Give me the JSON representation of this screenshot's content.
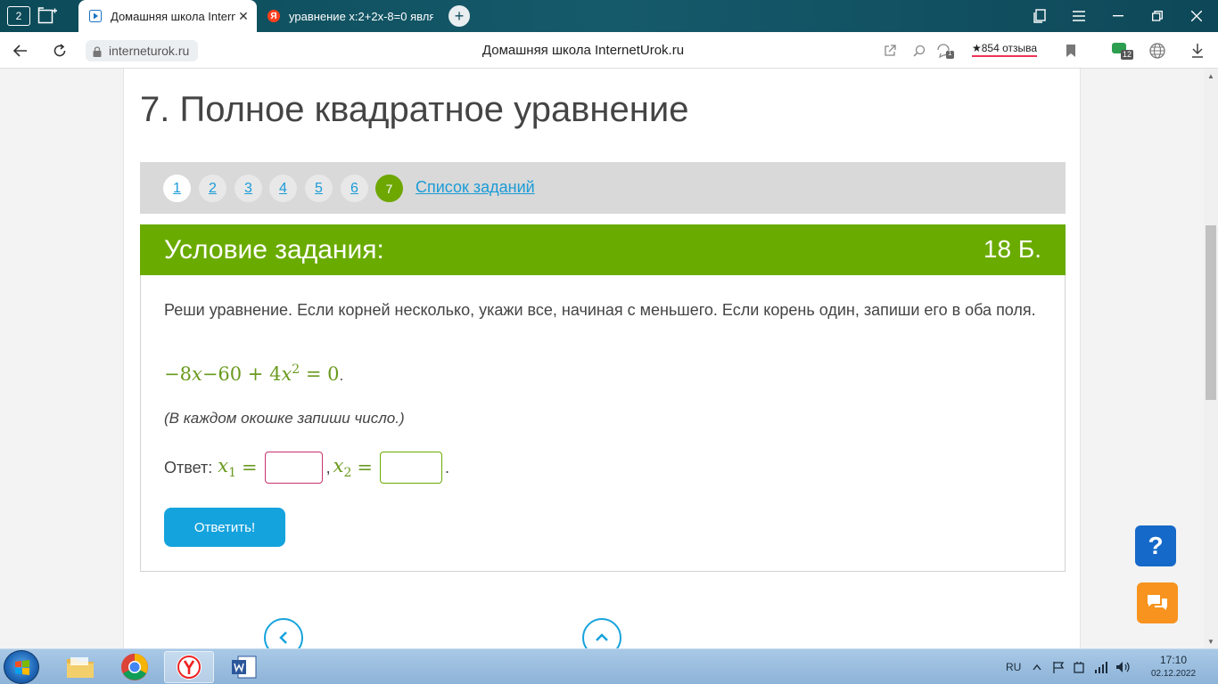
{
  "browser": {
    "tab_count": "2",
    "tabs": [
      {
        "title": "Домашняя школа InternetUrok",
        "close": "✕"
      },
      {
        "title": "уравнение x:2+2x-8=0 является",
        "favicon_letter": "Я"
      }
    ],
    "new_tab": "+",
    "url": "interneturok.ru",
    "page_title": "Домашняя школа InternetUrok.ru",
    "reviews": "★854 отзыва",
    "notif_count": "1",
    "ext_count": "12"
  },
  "page": {
    "heading": "7. Полное квадратное уравнение",
    "pager": {
      "pages": [
        "1",
        "2",
        "3",
        "4",
        "5",
        "6",
        "7"
      ],
      "current": "7",
      "list_link": "Список заданий"
    },
    "task": {
      "header": "Условие задания:",
      "points": "18 Б.",
      "condition": "Реши уравнение. Если корней несколько, укажи все, начиная с меньшего. Если корень один, запиши его в оба поля.",
      "equation": {
        "a": "−8",
        "b": "−60 + 4",
        "exp": "2",
        "rhs": "= 0"
      },
      "hint": "(В каждом окошке запиши число.)",
      "answer_label": "Ответ:",
      "x1_value": "",
      "x2_value": "",
      "submit": "Ответить!"
    },
    "help": "?"
  },
  "taskbar": {
    "lang": "RU",
    "time": "17:10",
    "date": "02.12.2022"
  }
}
